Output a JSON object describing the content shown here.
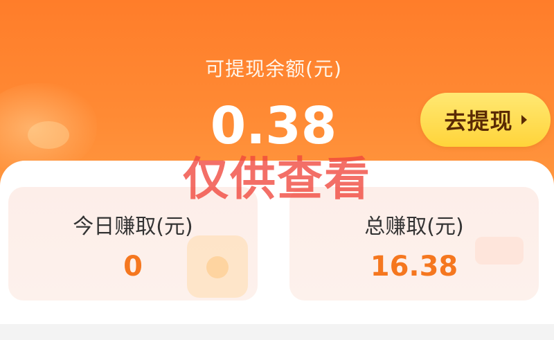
{
  "header": {
    "balance_label": "可提现余额(元)",
    "balance_value": "0.38",
    "withdraw_button_label": "去提现",
    "bg_color": "#ff8a34"
  },
  "stats": {
    "today": {
      "label": "今日赚取(元)",
      "value": "0"
    },
    "total": {
      "label": "总赚取(元)",
      "value": "16.38"
    }
  },
  "overlay": {
    "watermark": "仅供查看"
  },
  "colors": {
    "accent": "#f5771f",
    "button": "#ffd43a",
    "card_bg": "#fdeee9"
  },
  "icons": {
    "withdraw_arrow": "chevron-right-icon"
  }
}
